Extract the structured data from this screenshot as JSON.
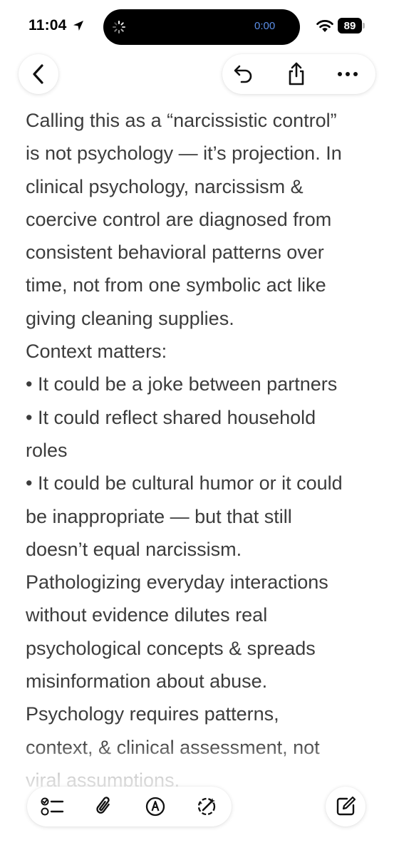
{
  "status_bar": {
    "time": "11:04",
    "timer": "0:00",
    "battery": "89",
    "icons": [
      "location-arrow-icon",
      "spinner-icon",
      "wifi-icon",
      "battery-icon"
    ]
  },
  "toolbar": {
    "icons": [
      "chevron-left-icon",
      "undo-icon",
      "share-icon",
      "more-icon"
    ]
  },
  "note": {
    "lines": [
      "Calling this as a “narcissistic control”",
      "is not psychology — it’s projection. In",
      "clinical psychology, narcissism &",
      "coercive control are diagnosed from",
      "consistent behavioral patterns over",
      "time, not from one symbolic act like",
      "giving cleaning supplies.",
      "Context matters:",
      "• It could be a joke between partners",
      "• It could reflect shared household",
      "roles",
      "• It could be cultural humor or it could",
      "be inappropriate — but that still",
      "doesn’t equal narcissism.",
      "Pathologizing everyday interactions",
      "without evidence dilutes real",
      "psychological concepts & spreads",
      "misinformation about abuse.",
      "Psychology requires patterns,",
      "context, & clinical assessment, not",
      "viral assumptions."
    ]
  },
  "bottom_bar": {
    "icons": [
      "checklist-icon",
      "paperclip-icon",
      "markup-pen-icon",
      "writing-tools-icon",
      "compose-icon"
    ]
  },
  "colors": {
    "text": "#3c3c3c",
    "island_timer": "#5b8ee6",
    "background": "#ffffff"
  }
}
